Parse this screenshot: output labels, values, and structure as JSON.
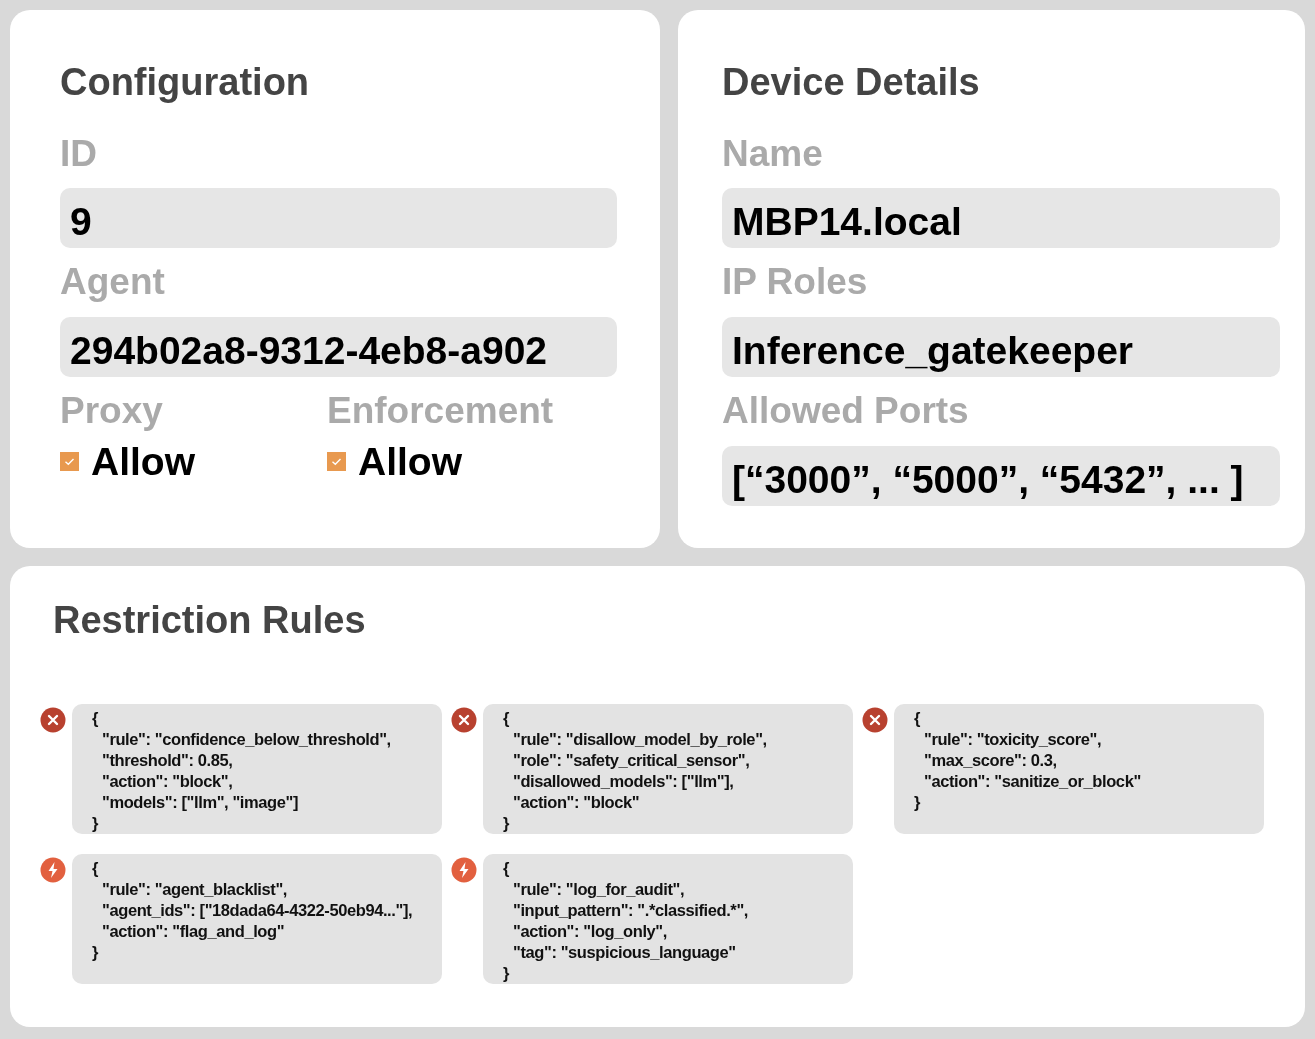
{
  "configuration": {
    "title": "Configuration",
    "fields": [
      {
        "label": "ID",
        "value": "9"
      },
      {
        "label": "Agent",
        "value": "294b02a8-9312-4eb8-a902"
      }
    ],
    "toggles": [
      {
        "label": "Proxy",
        "option": "Allow",
        "checked": true
      },
      {
        "label": "Enforcement",
        "option": "Allow",
        "checked": true
      }
    ]
  },
  "device_details": {
    "title": "Device Details",
    "fields": [
      {
        "label": "Name",
        "value": "MBP14.local"
      },
      {
        "label": "IP Roles",
        "value": "Inference_gatekeeper"
      },
      {
        "label": "Allowed Ports",
        "value": "[“3000”, “5000”, “5432”, ... ]"
      }
    ]
  },
  "restriction_rules": {
    "title": "Restriction Rules",
    "rules": [
      {
        "kind": "block",
        "lines": [
          "{",
          "\"rule\": \"confidence_below_threshold\",",
          "\"threshold\": 0.85,",
          "\"action\": \"block\",",
          "\"models\": [\"llm\", \"image\"]",
          "}"
        ]
      },
      {
        "kind": "block",
        "lines": [
          "{",
          "\"rule\": \"disallow_model_by_role\",",
          "\"role\": \"safety_critical_sensor\",",
          "\"disallowed_models\": [\"llm\"],",
          "\"action\": \"block\"",
          "}"
        ]
      },
      {
        "kind": "block",
        "lines": [
          "{",
          "\"rule\": \"toxicity_score\",",
          "\"max_score\": 0.3,",
          "\"action\": \"sanitize_or_block\"",
          "}"
        ]
      },
      {
        "kind": "flag",
        "lines": [
          "{",
          "\"rule\": \"agent_blacklist\",",
          "\"agent_ids\": [\"18dada64-4322-50eb94...\"],",
          "\"action\": \"flag_and_log\"",
          "}"
        ]
      },
      {
        "kind": "flag",
        "lines": [
          "{",
          "\"rule\": \"log_for_audit\",",
          "\"input_pattern\": \".*classified.*\",",
          "\"action\": \"log_only\",",
          "\"tag\": \"suspicious_language\"",
          "}"
        ]
      }
    ]
  }
}
